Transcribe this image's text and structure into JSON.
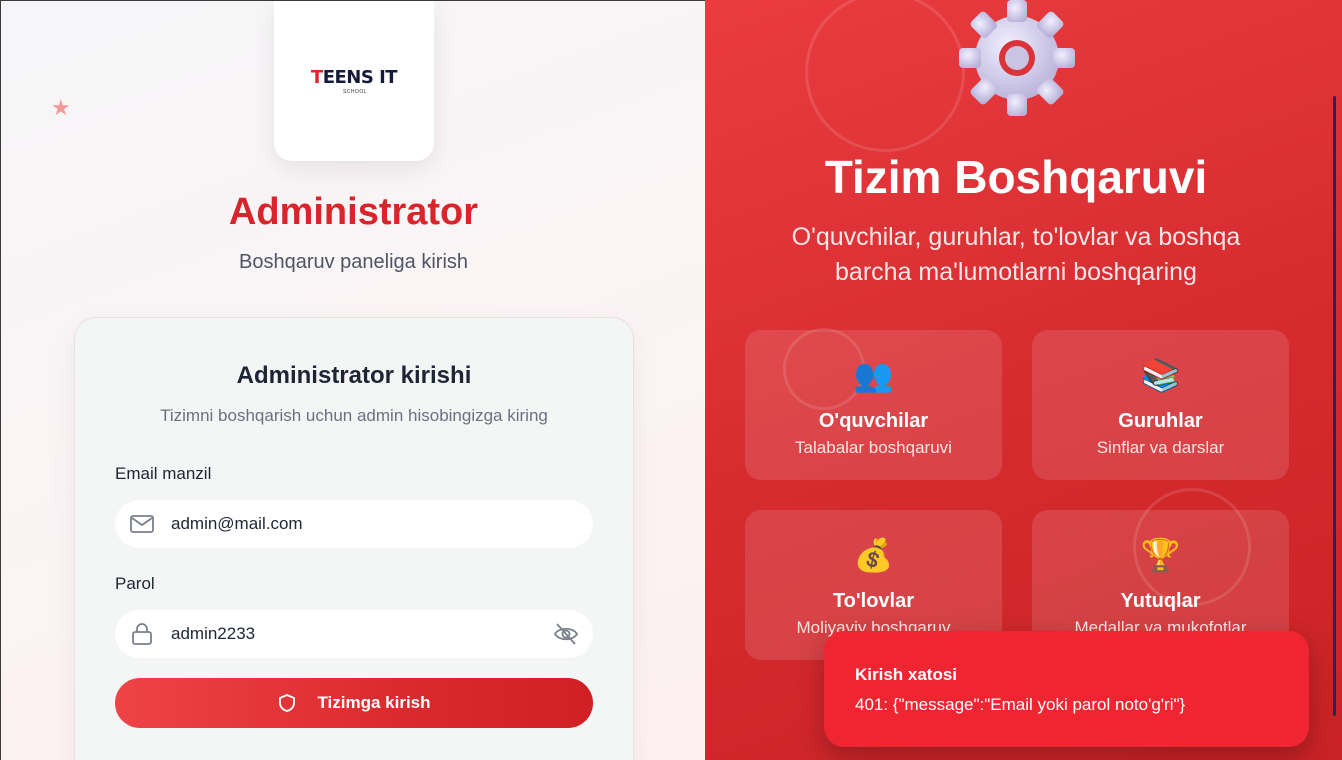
{
  "logo": {
    "brand": "TEENS IT",
    "brand_first": "T",
    "brand_rest": "EENS IT",
    "tagline": "SCHOOL"
  },
  "header": {
    "title": "Administrator",
    "subtitle": "Boshqaruv paneliga kirish"
  },
  "login_card": {
    "title": "Administrator kirishi",
    "subtitle": "Tizimni boshqarish uchun admin hisobingizga kiring",
    "email_label": "Email manzil",
    "email_value": "admin@mail.com",
    "password_label": "Parol",
    "password_value": "admin2233",
    "submit_label": "Tizimga kirish"
  },
  "promo": {
    "title": "Tizim Boshqaruvi",
    "subtitle_line1": "O'quvchilar, guruhlar, to'lovlar va boshqa",
    "subtitle_line2": "barcha ma'lumotlarni boshqaring",
    "tiles": [
      {
        "icon": "people-icon",
        "emoji": "👥",
        "name": "O'quvchilar",
        "desc": "Talabalar boshqaruvi"
      },
      {
        "icon": "books-icon",
        "emoji": "📚",
        "name": "Guruhlar",
        "desc": "Sinflar va darslar"
      },
      {
        "icon": "money-bag-icon",
        "emoji": "💰",
        "name": "To'lovlar",
        "desc": "Moliyaviy boshqaruv"
      },
      {
        "icon": "trophy-icon",
        "emoji": "🏆",
        "name": "Yutuqlar",
        "desc": "Medallar va mukofotlar"
      }
    ]
  },
  "toast": {
    "title": "Kirish xatosi",
    "message": "401: {\"message\":\"Email yoki parol noto'g'ri\"}"
  },
  "colors": {
    "accent": "#d8242a",
    "panel": "#d62c30",
    "toast": "#f02532"
  }
}
